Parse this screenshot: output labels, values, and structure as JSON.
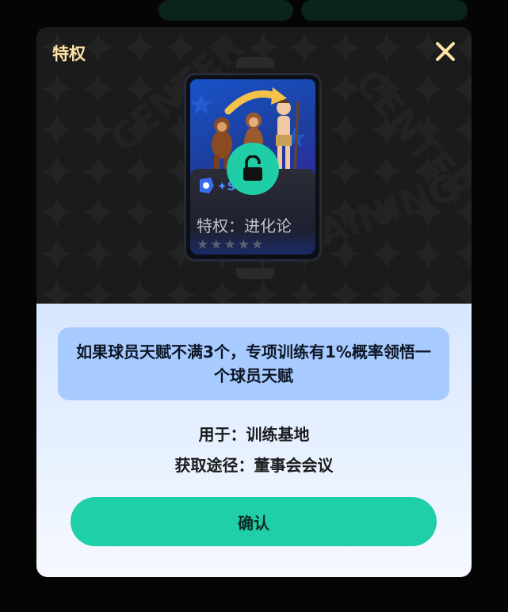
{
  "modal": {
    "title": "特权",
    "close_icon": "close-icon"
  },
  "card": {
    "name": "特权：进化论",
    "badge_text": "✦S",
    "stars": "★★★★★",
    "art_icon": "evolution-illustration",
    "lock_icon": "unlock-icon"
  },
  "details": {
    "description": "如果球员天赋不满3个，专项训练有1%概率领悟一个球员天赋",
    "used_for": "用于：训练基地",
    "obtain": "获取途径：董事会会议"
  },
  "actions": {
    "confirm_label": "确认"
  },
  "colors": {
    "accent": "#1ecfa7",
    "title": "#ffe3a6",
    "desc_bg": "#a7caff"
  }
}
